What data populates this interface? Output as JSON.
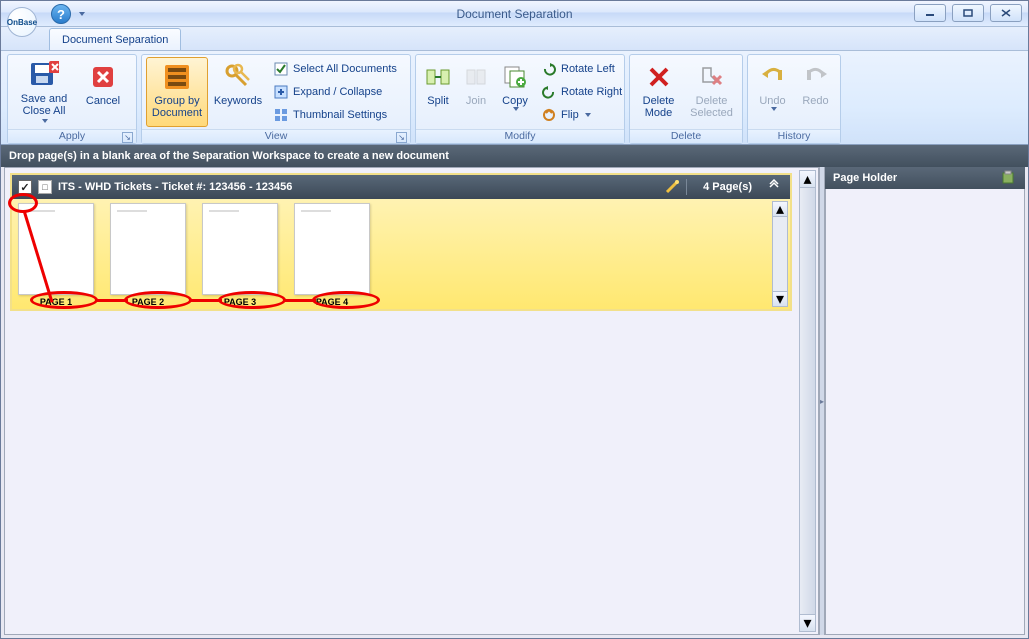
{
  "window": {
    "title": "Document Separation"
  },
  "tab": {
    "label": "Document Separation"
  },
  "ribbon": {
    "apply": {
      "group_label": "Apply",
      "save_and_close": "Save and Close All",
      "cancel": "Cancel"
    },
    "view": {
      "group_label": "View",
      "group_by_document": "Group by Document",
      "keywords": "Keywords",
      "select_all": "Select All Documents",
      "expand_collapse": "Expand / Collapse",
      "thumbnail_settings": "Thumbnail Settings"
    },
    "modify": {
      "group_label": "Modify",
      "split": "Split",
      "join": "Join",
      "copy": "Copy",
      "rotate_left": "Rotate Left",
      "rotate_right": "Rotate Right",
      "flip": "Flip"
    },
    "delete": {
      "group_label": "Delete",
      "delete_mode": "Delete Mode",
      "delete_selected": "Delete Selected"
    },
    "history": {
      "group_label": "History",
      "undo": "Undo",
      "redo": "Redo"
    }
  },
  "instruction": "Drop page(s) in a blank area of the Separation Workspace to create a new document",
  "document": {
    "title": "ITS - WHD Tickets - Ticket #: 123456 - 123456",
    "page_count_label": "4 Page(s)",
    "pages": [
      {
        "label": "PAGE 1"
      },
      {
        "label": "PAGE 2"
      },
      {
        "label": "PAGE 3"
      },
      {
        "label": "PAGE 4"
      }
    ]
  },
  "holder": {
    "title": "Page Holder"
  },
  "logo_text": "OnBase",
  "colors": {
    "ribbon_blue": "#d6e4fa",
    "highlight_orange": "#ffd97a",
    "annotation_red": "#e00000"
  }
}
